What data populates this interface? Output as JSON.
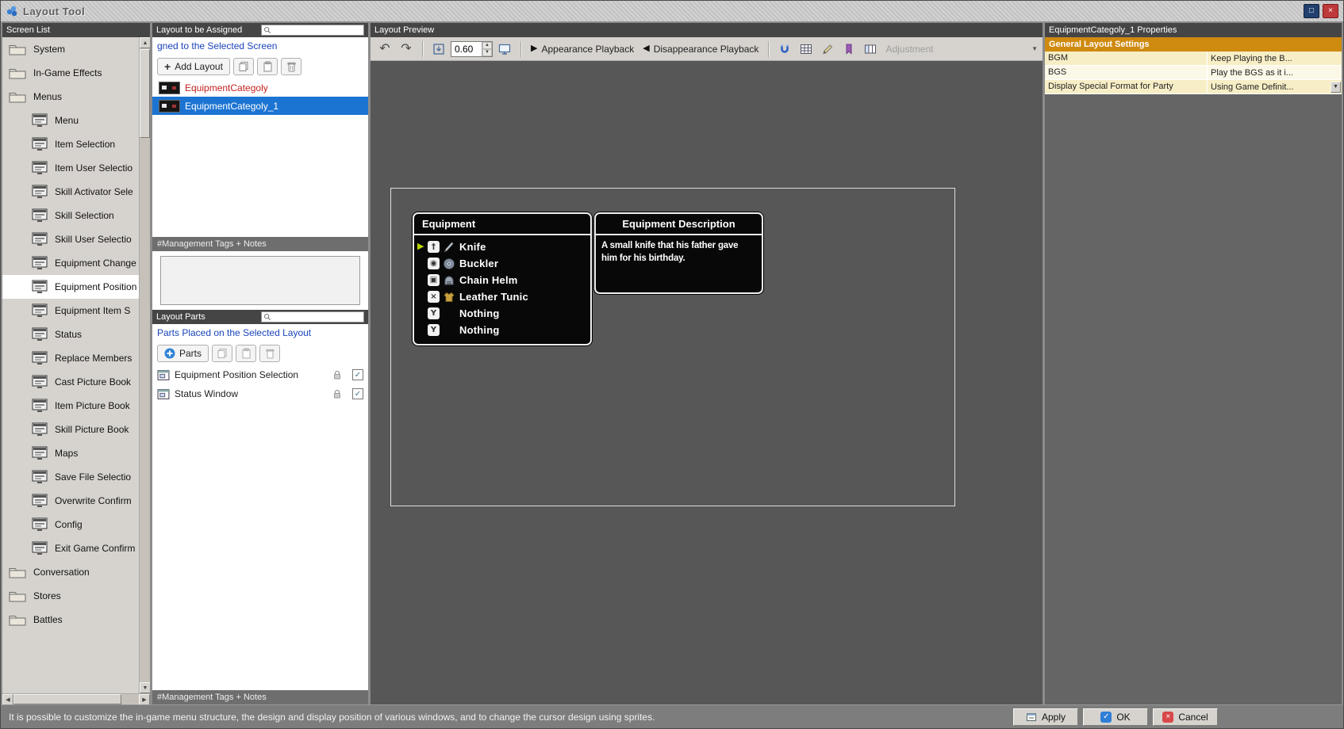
{
  "window": {
    "title": "Layout Tool",
    "statusbar": {
      "message": "It is possible to customize the in-game menu structure, the design and display position of various windows, and to change the cursor design using sprites.",
      "apply_label": "Apply",
      "ok_label": "OK",
      "cancel_label": "Cancel"
    }
  },
  "icons": {
    "restore": "□",
    "close": "×",
    "plus": "+",
    "undo": "↶",
    "redo": "↷",
    "up": "▲",
    "down": "▼",
    "left": "◀",
    "right": "▶",
    "play": "▶",
    "reverse": "◀",
    "check": "✓",
    "cursor": "▶"
  },
  "colors": {
    "selection_blue": "#1c74d2",
    "link_blue": "#1b44bb",
    "alert_red": "#c42020",
    "section_orange": "#cf8a10",
    "cursor_green": "#b9d502"
  },
  "screen_list": {
    "header": "Screen List",
    "items": [
      {
        "label": "System",
        "type": "folder"
      },
      {
        "label": "In-Game Effects",
        "type": "folder"
      },
      {
        "label": "Menus",
        "type": "folder"
      },
      {
        "label": "Menu",
        "type": "screen"
      },
      {
        "label": "Item Selection",
        "type": "screen"
      },
      {
        "label": "Item User Selectio",
        "type": "screen"
      },
      {
        "label": "Skill Activator Sele",
        "type": "screen"
      },
      {
        "label": "Skill Selection",
        "type": "screen"
      },
      {
        "label": "Skill User Selectio",
        "type": "screen"
      },
      {
        "label": "Equipment Change",
        "type": "screen"
      },
      {
        "label": "Equipment Position",
        "type": "screen",
        "selected": true
      },
      {
        "label": "Equipment Item S",
        "type": "screen"
      },
      {
        "label": "Status",
        "type": "screen"
      },
      {
        "label": "Replace Members",
        "type": "screen"
      },
      {
        "label": "Cast Picture Book",
        "type": "screen"
      },
      {
        "label": "Item Picture Book",
        "type": "screen"
      },
      {
        "label": "Skill Picture Book",
        "type": "screen"
      },
      {
        "label": "Maps",
        "type": "screen"
      },
      {
        "label": "Save File Selectio",
        "type": "screen"
      },
      {
        "label": "Overwrite Confirm",
        "type": "screen"
      },
      {
        "label": "Config",
        "type": "screen"
      },
      {
        "label": "Exit Game Confirm",
        "type": "screen"
      },
      {
        "label": "Conversation",
        "type": "folder"
      },
      {
        "label": "Stores",
        "type": "folder"
      },
      {
        "label": "Battles",
        "type": "folder"
      }
    ]
  },
  "layout_panel": {
    "header": "Layout to be Assigned",
    "subtitle": "gned to the Selected Screen",
    "add_layout_label": "Add Layout",
    "layouts": [
      {
        "name": "EquipmentCategoly",
        "name_color": "#c42020"
      },
      {
        "name": "EquipmentCategoly_1",
        "selected": true
      }
    ],
    "tags_header": "#Management Tags + Notes",
    "parts_header": "Layout Parts",
    "parts_subtitle": "Parts Placed on the Selected Layout",
    "add_parts_label": "Parts",
    "parts": [
      {
        "name": "Equipment Position Selection"
      },
      {
        "name": "Status Window"
      }
    ],
    "tags_header_bottom": "#Management Tags + Notes"
  },
  "preview": {
    "header": "Layout Preview",
    "zoom_value": "0.60",
    "appearance_label": "Appearance Playback",
    "disappearance_label": "Disappearance Playback",
    "adjustment_label": "Adjustment",
    "game": {
      "equipment_window": {
        "title": "Equipment",
        "items": [
          {
            "name": "Knife",
            "slot_glyph": "†",
            "icon": "knife",
            "cursor": true
          },
          {
            "name": "Buckler",
            "slot_glyph": "◉",
            "icon": "buckler"
          },
          {
            "name": "Chain Helm",
            "slot_glyph": "▣",
            "icon": "helm"
          },
          {
            "name": "Leather Tunic",
            "slot_glyph": "×",
            "icon": "tunic"
          },
          {
            "name": "Nothing",
            "slot_glyph": "Y",
            "icon": null
          },
          {
            "name": "Nothing",
            "slot_glyph": "Y",
            "icon": null
          }
        ]
      },
      "description_window": {
        "title": "Equipment Description",
        "text": "A small knife that his father gave him for his birthday."
      }
    }
  },
  "properties": {
    "header": "EquipmentCategoly_1 Properties",
    "section": "General Layout Settings",
    "rows": [
      {
        "label": "BGM",
        "value": "Keep Playing the B...",
        "dropdown": false
      },
      {
        "label": "BGS",
        "value": "Play the BGS as it i...",
        "dropdown": false
      },
      {
        "label": "Display Special Format for Party",
        "value": "Using Game Definit...",
        "dropdown": true
      }
    ]
  }
}
